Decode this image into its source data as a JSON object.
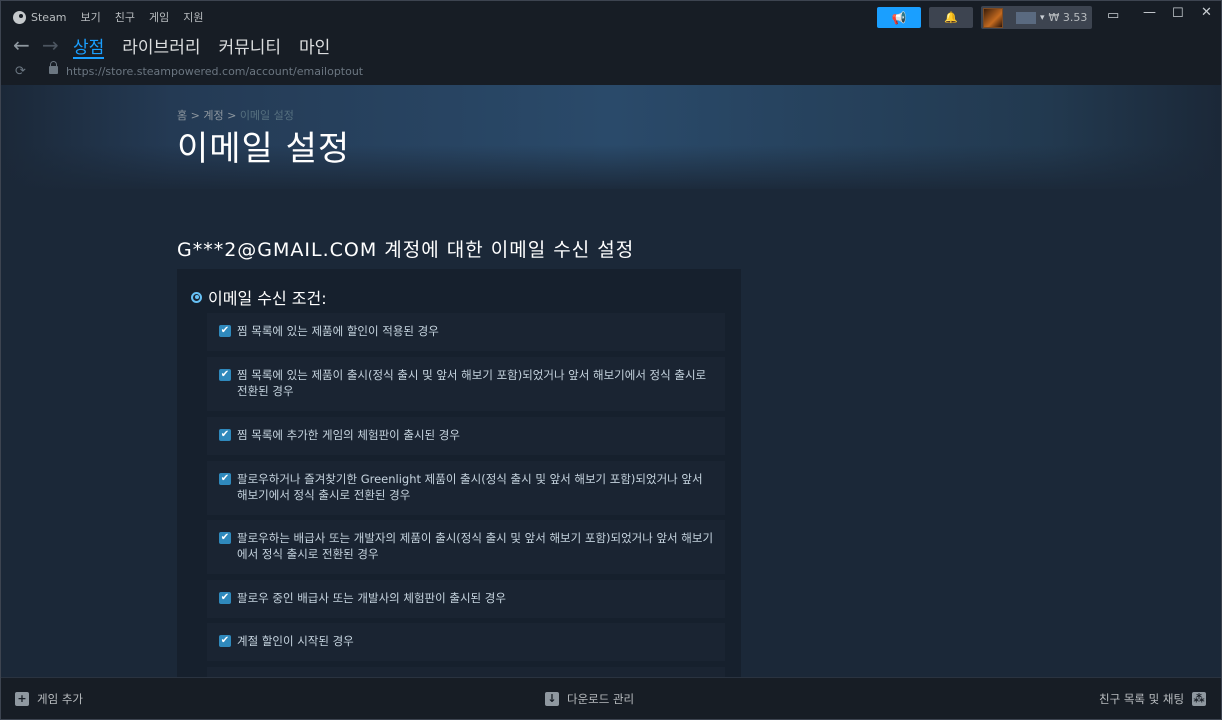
{
  "titlebar": {
    "app_name": "Steam",
    "menu": [
      "보기",
      "친구",
      "게임",
      "지원"
    ],
    "wallet": "₩ 3.53"
  },
  "nav": {
    "tabs": [
      {
        "label": "상점",
        "active": true
      },
      {
        "label": "라이브러리",
        "active": false
      },
      {
        "label": "커뮤니티",
        "active": false
      },
      {
        "label": "마인",
        "active": false
      }
    ],
    "url": "https://store.steampowered.com/account/emailoptout"
  },
  "page": {
    "breadcrumb": {
      "home": "홈",
      "sep": ">",
      "account": "계정",
      "current": "이메일 설정"
    },
    "title": "이메일 설정",
    "section_title": "G***2@GMAIL.COM 계정에 대한 이메일 수신 설정",
    "conditions_label": "이메일 수신 조건:",
    "options": [
      {
        "label": "찜 목록에 있는 제품에 할인이 적용된 경우",
        "checked": true
      },
      {
        "label": "찜 목록에 있는 제품이 출시(정식 출시 및 앞서 해보기 포함)되었거나 앞서 해보기에서 정식 출시로 전환된 경우",
        "checked": true
      },
      {
        "label": "찜 목록에 추가한 게임의 체험판이 출시된 경우",
        "checked": true
      },
      {
        "label": "팔로우하거나 즐겨찾기한 Greenlight 제품이 출시(정식 출시 및 앞서 해보기 포함)되었거나 앞서 해보기에서 정식 출시로 전환된 경우",
        "checked": true
      },
      {
        "label": "팔로우하는 배급사 또는 개발자의 제품이 출시(정식 출시 및 앞서 해보기 포함)되었거나 앞서 해보기에서 정식 출시로 전환된 경우",
        "checked": true
      },
      {
        "label": "팔로우 중인 배급사 또는 개발사의 체험판이 출시된 경우",
        "checked": true
      },
      {
        "label": "계절 할인이 시작된 경우",
        "checked": true
      }
    ]
  },
  "bottombar": {
    "add_game": "게임 추가",
    "downloads": "다운로드 관리",
    "friends": "친구 목록 및 채팅"
  },
  "colors": {
    "accent": "#1a9fff",
    "background": "#1b2838",
    "checkbox": "#2f89bc"
  }
}
